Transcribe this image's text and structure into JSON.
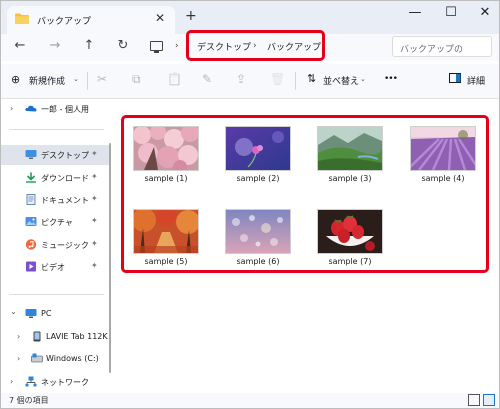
{
  "titlebar": {
    "tab_title": "バックアップ",
    "close_tab": "✕",
    "new_tab": "+",
    "minimize": "—",
    "maximize": "☐",
    "close_window": "✕"
  },
  "address": {
    "back": "←",
    "forward": "→",
    "up": "↑",
    "refresh": "↻",
    "breadcrumb": [
      "デスクトップ",
      "バックアップ"
    ],
    "chevron": "›",
    "search_placeholder": "バックアップの"
  },
  "commandbar": {
    "new_label": "新規作成",
    "new_icon": "⊕",
    "sort_label": "並べ替え",
    "sort_icon": "⇅",
    "more": "•••",
    "details_label": "詳細",
    "icons": [
      "cut-icon",
      "copy-icon",
      "paste-icon",
      "rename-icon",
      "share-icon",
      "delete-icon"
    ],
    "icon_glyphs": [
      "✂",
      "⧉",
      "📋",
      "✎",
      "⇪",
      "🗑"
    ]
  },
  "navpane": {
    "onedrive": "一郎 - 個人用",
    "quick": [
      {
        "label": "デスクトップ",
        "icon": "desktop-icon"
      },
      {
        "label": "ダウンロード",
        "icon": "download-icon"
      },
      {
        "label": "ドキュメント",
        "icon": "document-icon"
      },
      {
        "label": "ピクチャ",
        "icon": "pictures-icon"
      },
      {
        "label": "ミュージック",
        "icon": "music-icon"
      },
      {
        "label": "ビデオ",
        "icon": "video-icon"
      }
    ],
    "pc": "PC",
    "pc_children": [
      "LAVIE Tab 112K",
      "Windows (C:)"
    ],
    "network": "ネットワーク",
    "pin": "📌",
    "caret_right": "›",
    "caret_down": "⌄"
  },
  "files": [
    {
      "name": "sample (1)",
      "theme": "cherry-blossom"
    },
    {
      "name": "sample (2)",
      "theme": "purple-flower"
    },
    {
      "name": "sample (3)",
      "theme": "green-hills"
    },
    {
      "name": "sample (4)",
      "theme": "lavender-field"
    },
    {
      "name": "sample (5)",
      "theme": "autumn-trees"
    },
    {
      "name": "sample (6)",
      "theme": "bokeh-lights"
    },
    {
      "name": "sample (7)",
      "theme": "strawberries"
    }
  ],
  "status": {
    "item_count": "7 個の項目"
  },
  "colors": {
    "highlight_red": "#e4001b",
    "accent_blue": "#1a73c4",
    "folder_yellow": "#f3c33d"
  }
}
